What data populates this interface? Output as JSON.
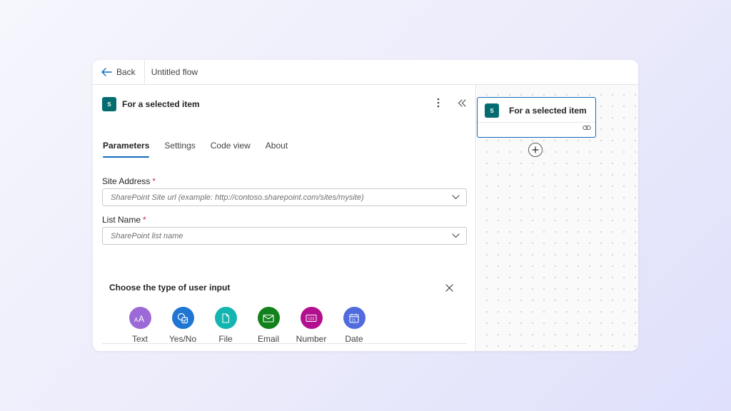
{
  "topbar": {
    "back_label": "Back",
    "flow_title": "Untitled flow"
  },
  "panel": {
    "icon_text": "S",
    "title": "For a selected item",
    "tabs": [
      {
        "label": "Parameters",
        "active": true
      },
      {
        "label": "Settings",
        "active": false
      },
      {
        "label": "Code view",
        "active": false
      },
      {
        "label": "About",
        "active": false
      }
    ],
    "site_address": {
      "label": "Site Address",
      "required_mark": "*",
      "placeholder": "SharePoint Site url (example: http://contoso.sharepoint.com/sites/mysite)"
    },
    "list_name": {
      "label": "List Name",
      "required_mark": "*",
      "placeholder": "SharePoint list name"
    },
    "user_input": {
      "title": "Choose the type of user input",
      "types": [
        {
          "label": "Text",
          "color": "#9c6ad6",
          "icon": "text-icon"
        },
        {
          "label": "Yes/No",
          "color": "#1f76d3",
          "icon": "yes-no-icon"
        },
        {
          "label": "File",
          "color": "#12b5b0",
          "icon": "file-icon"
        },
        {
          "label": "Email",
          "color": "#11811b",
          "icon": "email-icon"
        },
        {
          "label": "Number",
          "color": "#b3108f",
          "icon": "number-icon"
        },
        {
          "label": "Date",
          "color": "#4f6bdd",
          "icon": "date-icon"
        }
      ]
    }
  },
  "canvas": {
    "node_title": "For a selected item",
    "node_icon_text": "S"
  },
  "colors": {
    "accent": "#0f6cbd",
    "sharepoint": "#036c70",
    "required": "#c4314b"
  }
}
